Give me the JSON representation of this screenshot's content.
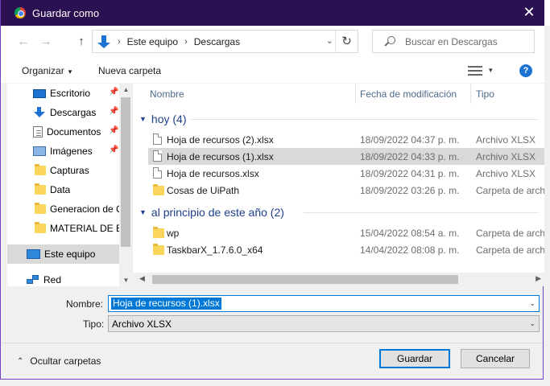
{
  "window": {
    "title": "Guardar como",
    "close_glyph": "✕"
  },
  "nav": {
    "back_glyph": "←",
    "forward_glyph": "→",
    "up_glyph": "↑",
    "breadcrumb": [
      "Este equipo",
      "Descargas"
    ],
    "separator": "›",
    "dropdown_glyph": "⌄",
    "refresh_glyph": "↻",
    "search_placeholder": "Buscar en Descargas"
  },
  "toolbar": {
    "organize_label": "Organizar",
    "new_folder_label": "Nueva carpeta",
    "caret": "▾",
    "help_glyph": "?"
  },
  "sidebar": {
    "items": [
      {
        "label": "Escritorio",
        "icon": "desktop-icon",
        "pinned": true
      },
      {
        "label": "Descargas",
        "icon": "download-icon",
        "pinned": true
      },
      {
        "label": "Documentos",
        "icon": "docs-icon",
        "pinned": true
      },
      {
        "label": "Imágenes",
        "icon": "images-icon",
        "pinned": true
      },
      {
        "label": "Capturas",
        "icon": "folder-icon",
        "pinned": false
      },
      {
        "label": "Data",
        "icon": "folder-icon",
        "pinned": false
      },
      {
        "label": "Generacion de C",
        "icon": "folder-icon",
        "pinned": false
      },
      {
        "label": "MATERIAL DE ES",
        "icon": "folder-icon",
        "pinned": false
      },
      {
        "label": "Este equipo",
        "icon": "computer-icon",
        "pinned": false,
        "selected": true
      },
      {
        "label": "Red",
        "icon": "network-icon",
        "pinned": false
      }
    ],
    "pin_glyph": "📌"
  },
  "columns": {
    "name": "Nombre",
    "date": "Fecha de modificación",
    "type": "Tipo",
    "sort_glyph": "⌃"
  },
  "groups": [
    {
      "label": "hoy (4)",
      "files": [
        {
          "name": "Hoja de recursos (2).xlsx",
          "date": "18/09/2022 04:37 p. m.",
          "type": "Archivo XLSX",
          "icon": "document-icon"
        },
        {
          "name": "Hoja de recursos (1).xlsx",
          "date": "18/09/2022 04:33 p. m.",
          "type": "Archivo XLSX",
          "icon": "document-icon",
          "selected": true
        },
        {
          "name": "Hoja de recursos.xlsx",
          "date": "18/09/2022 04:31 p. m.",
          "type": "Archivo XLSX",
          "icon": "document-icon"
        },
        {
          "name": "Cosas de UiPath",
          "date": "18/09/2022 03:26 p. m.",
          "type": "Carpeta de archi",
          "icon": "folder-icon"
        }
      ]
    },
    {
      "label": "al principio de este año (2)",
      "files": [
        {
          "name": "wp",
          "date": "15/04/2022 08:54 a. m.",
          "type": "Carpeta de archi",
          "icon": "folder-icon"
        },
        {
          "name": "TaskbarX_1.7.6.0_x64",
          "date": "14/04/2022 08:08 p. m.",
          "type": "Carpeta de archi",
          "icon": "folder-icon"
        }
      ]
    }
  ],
  "form": {
    "filename_label": "Nombre:",
    "filename_value": "Hoja de recursos (1).xlsx",
    "type_label": "Tipo:",
    "type_value": "Archivo XLSX"
  },
  "footer": {
    "hide_folders_label": "Ocultar carpetas",
    "save_label": "Guardar",
    "cancel_label": "Cancelar"
  },
  "colors": {
    "titlebar": "#2b1052",
    "accent": "#0078d7",
    "group_header": "#1e3f8c"
  }
}
